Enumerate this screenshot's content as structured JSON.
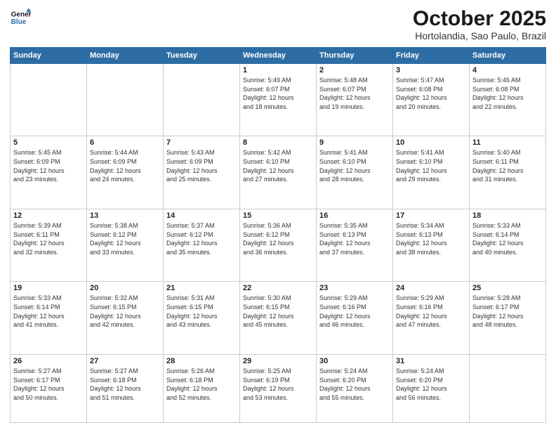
{
  "header": {
    "logo_line1": "General",
    "logo_line2": "Blue",
    "title": "October 2025",
    "subtitle": "Hortolandia, Sao Paulo, Brazil"
  },
  "days_of_week": [
    "Sunday",
    "Monday",
    "Tuesday",
    "Wednesday",
    "Thursday",
    "Friday",
    "Saturday"
  ],
  "weeks": [
    [
      {
        "num": "",
        "info": ""
      },
      {
        "num": "",
        "info": ""
      },
      {
        "num": "",
        "info": ""
      },
      {
        "num": "1",
        "info": "Sunrise: 5:49 AM\nSunset: 6:07 PM\nDaylight: 12 hours\nand 18 minutes."
      },
      {
        "num": "2",
        "info": "Sunrise: 5:48 AM\nSunset: 6:07 PM\nDaylight: 12 hours\nand 19 minutes."
      },
      {
        "num": "3",
        "info": "Sunrise: 5:47 AM\nSunset: 6:08 PM\nDaylight: 12 hours\nand 20 minutes."
      },
      {
        "num": "4",
        "info": "Sunrise: 5:46 AM\nSunset: 6:08 PM\nDaylight: 12 hours\nand 22 minutes."
      }
    ],
    [
      {
        "num": "5",
        "info": "Sunrise: 5:45 AM\nSunset: 6:09 PM\nDaylight: 12 hours\nand 23 minutes."
      },
      {
        "num": "6",
        "info": "Sunrise: 5:44 AM\nSunset: 6:09 PM\nDaylight: 12 hours\nand 24 minutes."
      },
      {
        "num": "7",
        "info": "Sunrise: 5:43 AM\nSunset: 6:09 PM\nDaylight: 12 hours\nand 25 minutes."
      },
      {
        "num": "8",
        "info": "Sunrise: 5:42 AM\nSunset: 6:10 PM\nDaylight: 12 hours\nand 27 minutes."
      },
      {
        "num": "9",
        "info": "Sunrise: 5:41 AM\nSunset: 6:10 PM\nDaylight: 12 hours\nand 28 minutes."
      },
      {
        "num": "10",
        "info": "Sunrise: 5:41 AM\nSunset: 6:10 PM\nDaylight: 12 hours\nand 29 minutes."
      },
      {
        "num": "11",
        "info": "Sunrise: 5:40 AM\nSunset: 6:11 PM\nDaylight: 12 hours\nand 31 minutes."
      }
    ],
    [
      {
        "num": "12",
        "info": "Sunrise: 5:39 AM\nSunset: 6:11 PM\nDaylight: 12 hours\nand 32 minutes."
      },
      {
        "num": "13",
        "info": "Sunrise: 5:38 AM\nSunset: 6:12 PM\nDaylight: 12 hours\nand 33 minutes."
      },
      {
        "num": "14",
        "info": "Sunrise: 5:37 AM\nSunset: 6:12 PM\nDaylight: 12 hours\nand 35 minutes."
      },
      {
        "num": "15",
        "info": "Sunrise: 5:36 AM\nSunset: 6:12 PM\nDaylight: 12 hours\nand 36 minutes."
      },
      {
        "num": "16",
        "info": "Sunrise: 5:35 AM\nSunset: 6:13 PM\nDaylight: 12 hours\nand 37 minutes."
      },
      {
        "num": "17",
        "info": "Sunrise: 5:34 AM\nSunset: 6:13 PM\nDaylight: 12 hours\nand 38 minutes."
      },
      {
        "num": "18",
        "info": "Sunrise: 5:33 AM\nSunset: 6:14 PM\nDaylight: 12 hours\nand 40 minutes."
      }
    ],
    [
      {
        "num": "19",
        "info": "Sunrise: 5:33 AM\nSunset: 6:14 PM\nDaylight: 12 hours\nand 41 minutes."
      },
      {
        "num": "20",
        "info": "Sunrise: 5:32 AM\nSunset: 6:15 PM\nDaylight: 12 hours\nand 42 minutes."
      },
      {
        "num": "21",
        "info": "Sunrise: 5:31 AM\nSunset: 6:15 PM\nDaylight: 12 hours\nand 43 minutes."
      },
      {
        "num": "22",
        "info": "Sunrise: 5:30 AM\nSunset: 6:15 PM\nDaylight: 12 hours\nand 45 minutes."
      },
      {
        "num": "23",
        "info": "Sunrise: 5:29 AM\nSunset: 6:16 PM\nDaylight: 12 hours\nand 46 minutes."
      },
      {
        "num": "24",
        "info": "Sunrise: 5:29 AM\nSunset: 6:16 PM\nDaylight: 12 hours\nand 47 minutes."
      },
      {
        "num": "25",
        "info": "Sunrise: 5:28 AM\nSunset: 6:17 PM\nDaylight: 12 hours\nand 48 minutes."
      }
    ],
    [
      {
        "num": "26",
        "info": "Sunrise: 5:27 AM\nSunset: 6:17 PM\nDaylight: 12 hours\nand 50 minutes."
      },
      {
        "num": "27",
        "info": "Sunrise: 5:27 AM\nSunset: 6:18 PM\nDaylight: 12 hours\nand 51 minutes."
      },
      {
        "num": "28",
        "info": "Sunrise: 5:26 AM\nSunset: 6:18 PM\nDaylight: 12 hours\nand 52 minutes."
      },
      {
        "num": "29",
        "info": "Sunrise: 5:25 AM\nSunset: 6:19 PM\nDaylight: 12 hours\nand 53 minutes."
      },
      {
        "num": "30",
        "info": "Sunrise: 5:24 AM\nSunset: 6:20 PM\nDaylight: 12 hours\nand 55 minutes."
      },
      {
        "num": "31",
        "info": "Sunrise: 5:24 AM\nSunset: 6:20 PM\nDaylight: 12 hours\nand 56 minutes."
      },
      {
        "num": "",
        "info": ""
      }
    ]
  ]
}
